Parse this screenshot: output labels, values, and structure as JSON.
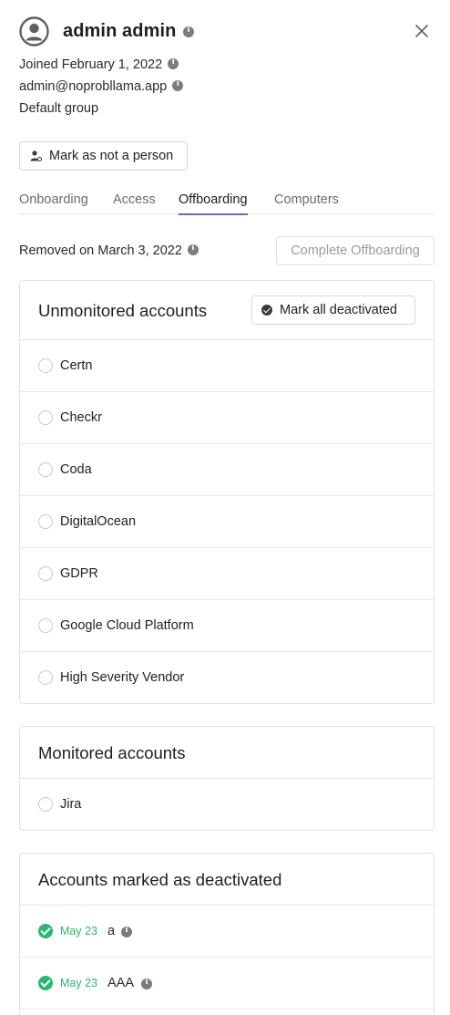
{
  "user": {
    "name": "admin admin",
    "joined": "Joined February 1, 2022",
    "email": "admin@noprobllama.app",
    "group": "Default group"
  },
  "actions": {
    "mark_not_person": "Mark as not a person"
  },
  "tabs": [
    {
      "label": "Onboarding",
      "active": false
    },
    {
      "label": "Access",
      "active": false
    },
    {
      "label": "Offboarding",
      "active": true
    },
    {
      "label": "Computers",
      "active": false
    }
  ],
  "offboarding": {
    "removed": "Removed on March 3, 2022",
    "complete_button": "Complete Offboarding"
  },
  "unmonitored": {
    "title": "Unmonitored accounts",
    "mark_all_button": "Mark all deactivated",
    "items": [
      "Certn",
      "Checkr",
      "Coda",
      "DigitalOcean",
      "GDPR",
      "Google Cloud Platform",
      "High Severity Vendor"
    ]
  },
  "monitored": {
    "title": "Monitored accounts",
    "items": [
      "Jira"
    ]
  },
  "deactivated": {
    "title": "Accounts marked as deactivated",
    "items": [
      {
        "date": "May 23",
        "name": "a"
      },
      {
        "date": "May 23",
        "name": "AAA"
      }
    ]
  },
  "colors": {
    "accent": "#7c5bd6",
    "success": "#2bb673"
  },
  "icons": [
    "user-avatar-icon",
    "info-icon",
    "close-icon",
    "person-icon",
    "check-circle-icon"
  ]
}
